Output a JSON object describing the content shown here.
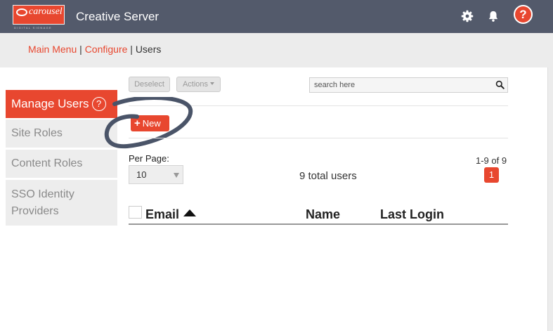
{
  "header": {
    "logo_word": "carousel",
    "logo_tagline": "DIGITAL SIGNAGE",
    "app_title": "Creative Server",
    "icons": [
      "gear-icon",
      "bell-icon",
      "help-icon"
    ],
    "help_label": "?"
  },
  "breadcrumb": {
    "items": [
      "Main Menu",
      "Configure",
      "Users"
    ],
    "separator": "|"
  },
  "sidebar": {
    "items": [
      {
        "label": "Manage Users",
        "help": "?",
        "active": true
      },
      {
        "label": "Site Roles",
        "active": false
      },
      {
        "label": "Content Roles",
        "active": false
      },
      {
        "label": "SSO Identity Providers",
        "line1": "SSO Identity",
        "line2": "Providers",
        "active": false
      }
    ]
  },
  "toolbar": {
    "deselect_label": "Deselect",
    "actions_label": "Actions",
    "search_placeholder": "search here",
    "new_label": "New",
    "new_icon": "plus-icon"
  },
  "pagination": {
    "per_page_label": "Per Page:",
    "per_page_value": "10",
    "total_text": "9 total users",
    "range_text": "1-9 of 9",
    "current_page": "1"
  },
  "table": {
    "columns": [
      "Email",
      "Name",
      "Last Login"
    ],
    "sort_column": "Email",
    "sort_direction": "ascending",
    "rows": []
  },
  "colors": {
    "accent": "#e8472f",
    "header_bg": "#535a6b",
    "breadcrumb_bg": "#ececec",
    "sidebar_bg": "#ededed",
    "annotation": "#4a5468"
  }
}
